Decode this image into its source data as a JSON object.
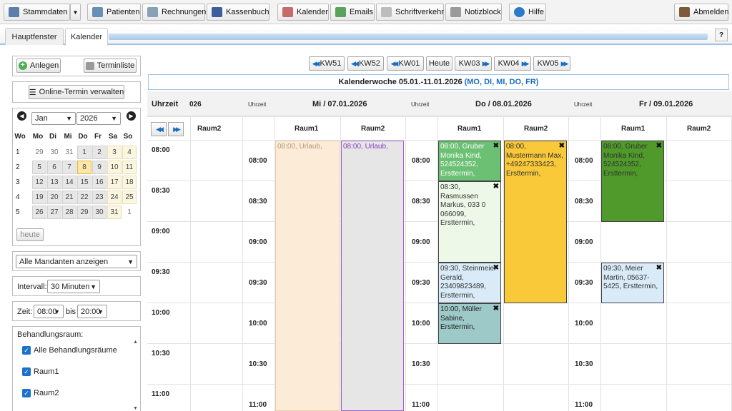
{
  "toolbar": {
    "stammdaten": "Stammdaten",
    "patienten": "Patienten",
    "rechnungen": "Rechnungen",
    "kassenbuch": "Kassenbuch",
    "kalender": "Kalender",
    "emails": "Emails",
    "schriftverkehr": "Schriftverkehr",
    "notizblock": "Notizblock",
    "hilfe": "Hilfe",
    "abmelden": "Abmelden"
  },
  "tabs": {
    "hauptfenster": "Hauptfenster",
    "kalender": "Kalender",
    "help": "?"
  },
  "sidebar": {
    "anlegen": "Anlegen",
    "terminliste": "Terminliste",
    "online_termin": "Online-Termin verwalten",
    "month": "Jan",
    "year": "2026",
    "weekday_headers": [
      "Wo",
      "Mo",
      "Di",
      "Mi",
      "Do",
      "Fr",
      "Sa",
      "So"
    ],
    "weeks": [
      {
        "wk": "1",
        "days": [
          "29",
          "30",
          "31",
          "1",
          "2",
          "3",
          "4"
        ]
      },
      {
        "wk": "2",
        "days": [
          "5",
          "6",
          "7",
          "8",
          "9",
          "10",
          "11"
        ]
      },
      {
        "wk": "3",
        "days": [
          "12",
          "13",
          "14",
          "15",
          "16",
          "17",
          "18"
        ]
      },
      {
        "wk": "4",
        "days": [
          "19",
          "20",
          "21",
          "22",
          "23",
          "24",
          "25"
        ]
      },
      {
        "wk": "5",
        "days": [
          "26",
          "27",
          "28",
          "29",
          "30",
          "31",
          "1"
        ]
      }
    ],
    "heute": "heute",
    "mandanten": "Alle Mandanten anzeigen",
    "intervall_label": "Intervall:",
    "intervall_value": "30 Minuten",
    "zeit_label": "Zeit:",
    "zeit_from": "08:00",
    "zeit_bis": "bis",
    "zeit_to": "20:00",
    "behandlungsraum_label": "Behandlungsraum:",
    "raeume": [
      "Alle Behandlungsräume",
      "Raum1",
      "Raum2"
    ]
  },
  "weeknav": {
    "buttons": [
      "KW51",
      "KW52",
      "KW01",
      "Heute",
      "KW03",
      "KW04",
      "KW05"
    ],
    "title": "Kalenderwoche 05.01.-11.01.2026",
    "days_links": "(MO, DI, MI, DO, FR)"
  },
  "calendar": {
    "uhrzeit": "Uhrzeit",
    "partial_header": "026",
    "days": [
      {
        "label": "Mi / 07.01.2026"
      },
      {
        "label": "Do / 08.01.2026"
      },
      {
        "label": "Fr / 09.01.2026"
      }
    ],
    "rooms": [
      "Raum1",
      "Raum2"
    ],
    "times": [
      "08:00",
      "08:30",
      "09:00",
      "09:30",
      "10:00",
      "10:30",
      "11:00"
    ],
    "appointments": [
      {
        "text": "08:00, Urlaub,",
        "bg": "#fcebd7",
        "color": "#b59978",
        "border": "#e8cda9"
      },
      {
        "text": "08:00, Urlaub,",
        "bg": "#e6e6e6",
        "color": "#8a3fbd",
        "border": "#a35fd0"
      },
      {
        "text": "08:00, Gruber Monika Kind, 524524352, Ersttermin,",
        "bg": "#6cc073",
        "color": "#fff"
      },
      {
        "text": "08:30, Rasmussen Markus, 033 0 066099, Ersttermin,",
        "bg": "#eef8e8",
        "color": "#333"
      },
      {
        "text": "09:30, Steinmeier Gerald, 23409823489, Ersttermin,",
        "bg": "#d9ebf8",
        "color": "#333"
      },
      {
        "text": "10:00, Müller Sabine, Ersttermin,",
        "bg": "#9ec9c9",
        "color": "#222"
      },
      {
        "text": "08:00, Mustermann Max, +49247333423, Ersttermin,",
        "bg": "#f9c93a",
        "color": "#333"
      },
      {
        "text": "08:00, Gruber Monika Kind, 524524352, Ersttermin,",
        "bg": "#4f9a2a",
        "color": "#333"
      },
      {
        "text": "09:30, Meier Martin, 05637-5425, Ersttermin,",
        "bg": "#d9ebf8",
        "color": "#333"
      }
    ]
  }
}
